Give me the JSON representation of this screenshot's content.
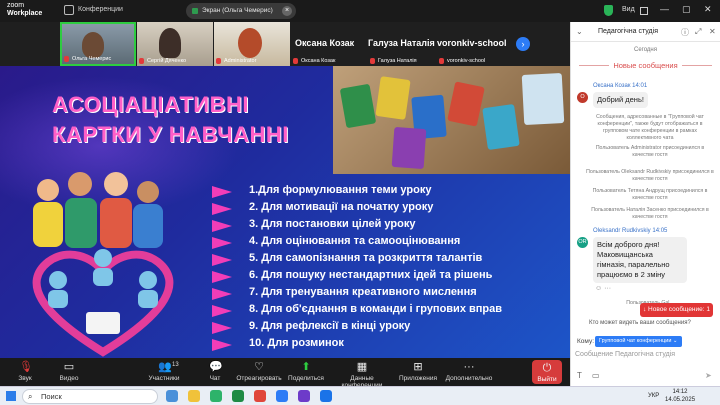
{
  "app": {
    "logo_top": "zoom",
    "logo_bottom": "Workplace",
    "conference_label": "Конференции"
  },
  "share": {
    "label": "Экран (Ольга Чемерис)"
  },
  "titlebar": {
    "view_label": "Вид",
    "minimize": "—",
    "maximize": "▢",
    "close": "✕"
  },
  "participants": [
    {
      "name": "Ольга Чемерис"
    },
    {
      "name": "Сергій Дяченко"
    },
    {
      "name": "Administrator"
    },
    {
      "name": "Оксана Козак",
      "big": "Оксана Козак"
    },
    {
      "name": "Галуза Наталія",
      "big": "Галуза Наталія"
    },
    {
      "name": "voronkiv-school",
      "big": "voronkiv-school"
    }
  ],
  "slide": {
    "title_line1": "АСОЦІАЦІАТИВНІ",
    "title_line2": "КАРТКИ У НАВЧАННІ",
    "items": [
      "1.Для формулювання теми уроку",
      "2. Для мотивації на початку уроку",
      "3. Для постановки цілей уроку",
      "4. Для оцінювання та самооцінювання",
      "5. Для самопізнання та розкриття талантів",
      "6. Для пошуку нестандартних ідей та рішень",
      "7. Для тренування креативного мислення",
      "8. Для об'єднання в команди і групових вправ",
      "9. Для рефлексії в кінці уроку",
      "10. Для розминок"
    ]
  },
  "toolbar": {
    "audio": "Звук",
    "video": "Видео",
    "participants": "Участники",
    "participants_count": "13",
    "chat": "Чат",
    "react": "Отреагировать",
    "share": "Поделиться",
    "summary": "Данные конференции",
    "apps": "Приложения",
    "more": "Дополнительно",
    "leave": "Выйти"
  },
  "chat": {
    "title": "Педагогічна студія",
    "day": "Сегодня",
    "new_messages": "Новые сообщения",
    "msg1": {
      "initial": "О",
      "sender": "Оксана Козак 14:01",
      "text": "Добрий день!"
    },
    "sys1": "Сообщения, адресованные в \"Групповой чат конференции\", также будут отображаться в групповом чате конференции в рамках коллективного чата",
    "sys2": "Пользователь Administrator присоединился в качестве гостя",
    "sys3": "Пользователь Oleksandr Rudkivskiy присоединился в качестве гостя",
    "sys4": "Пользователь Тетяна Андрущ присоединился в качестве гостя",
    "sys5": "Пользователь Наталія Засенко присоединился в качестве гостя",
    "msg2": {
      "initial": "OR",
      "sender": "Oleksandr Rudkivskiy 14:05",
      "text": "Всім доброго дня! Маковищанська гімназія, паралельно працюємо в 2 зміну"
    },
    "sys6": "Пользователь Gal...",
    "new_badge": "↓ Новое сообщение: 1",
    "who_can_see": "Кто может видеть ваши сообщения?",
    "to_label": "Кому:",
    "to_value": "Групповой чат конференции ⌄",
    "input_placeholder": "Сообщение Педагогічна студія"
  },
  "taskbar": {
    "search": "Поиск",
    "lang": "УКР",
    "time": "14:12",
    "date": "14.05.2025"
  },
  "colors": {
    "accent": "#2d7cf6",
    "slide_title": "#ff5fc8",
    "arrow": "#f23db8",
    "leave": "#d63b3b"
  }
}
